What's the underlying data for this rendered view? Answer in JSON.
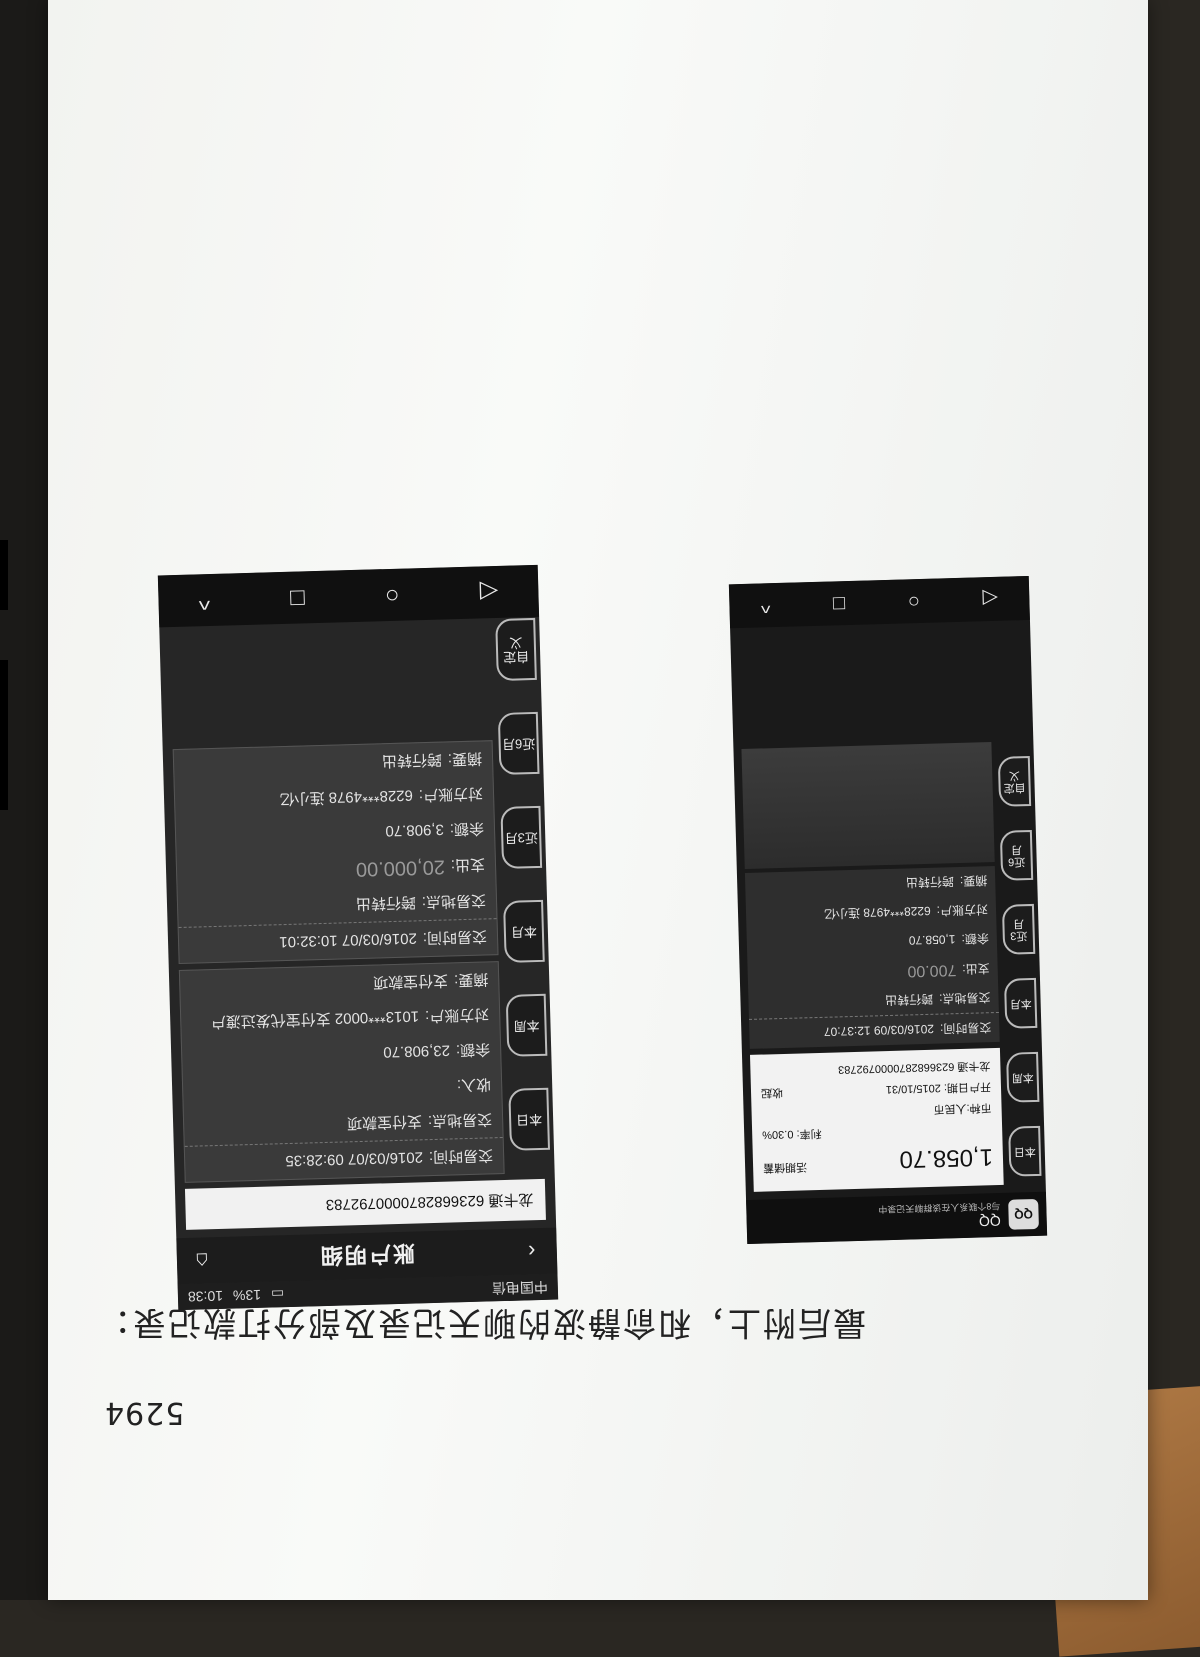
{
  "page": {
    "number": "5294",
    "caption": "最后附上，和俞静波的聊天记录及部分打款记录："
  },
  "phone1": {
    "status": {
      "carrier": "中国电信",
      "battery": "13%",
      "time": "10:38"
    },
    "title": "账户明细",
    "card": {
      "name": "龙卡通",
      "number": "6236682870000792783"
    },
    "side_tabs": [
      "本日",
      "本周",
      "本月",
      "近3月",
      "近6月",
      "自定义"
    ],
    "transactions": [
      {
        "time_label": "交易时间:",
        "time": "2016/03/07 09:28:35",
        "place_label": "交易地点:",
        "place": "支付宝款项",
        "in_label": "收入:",
        "in": "",
        "balance_label": "余额:",
        "balance": "23,908.70",
        "counterparty_label": "对方账户:",
        "counterparty": "1013***0002 支付宝代发过渡户",
        "summary_label": "摘要:",
        "summary": "支付宝款项"
      },
      {
        "time_label": "交易时间:",
        "time": "2016/03/07 10:32:01",
        "place_label": "交易地点:",
        "place": "跨行转出",
        "out_label": "支出:",
        "out": "20,000.00",
        "balance_label": "余额:",
        "balance": "3,908.70",
        "counterparty_label": "对方账户:",
        "counterparty": "6228***4978 连小亿",
        "summary_label": "摘要:",
        "summary": "跨行转出"
      }
    ],
    "nav": [
      "◁",
      "○",
      "□",
      "^"
    ]
  },
  "phone2": {
    "app": "QQ",
    "avatar": "QQ",
    "subtitle": "与8个联系人在该群聊天记录中",
    "balance": {
      "amount": "1,058.70",
      "type": "活期储蓄",
      "rate_label": "利率:",
      "rate": "0.30%",
      "currency_label": "币种:",
      "currency": "人民币",
      "open_label": "开户日期:",
      "open_date": "2015/10/31",
      "toggle": "收起",
      "card": "龙卡通 6236682870000792783"
    },
    "side_tabs": [
      "本日",
      "本周",
      "本月",
      "近3月",
      "近6月",
      "自定义"
    ],
    "transaction": {
      "time_label": "交易时间:",
      "time": "2016/03/09 12:37:07",
      "place_label": "交易地点:",
      "place": "跨行转出",
      "out_label": "支出:",
      "out": "700.00",
      "balance_label": "余额:",
      "balance": "1,058.70",
      "counterparty_label": "对方账户:",
      "counterparty": "6228***4978 连小亿",
      "summary_label": "摘要:",
      "summary": "跨行转出"
    },
    "nav": [
      "◁",
      "○",
      "□",
      "^"
    ]
  }
}
